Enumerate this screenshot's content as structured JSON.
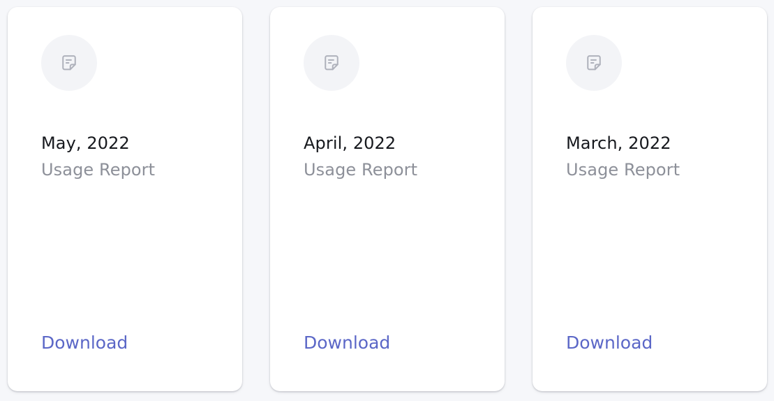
{
  "reports": [
    {
      "period": "May, 2022",
      "subtitle": "Usage Report",
      "action_label": "Download",
      "icon": "note-icon"
    },
    {
      "period": "April, 2022",
      "subtitle": "Usage Report",
      "action_label": "Download",
      "icon": "note-icon"
    },
    {
      "period": "March, 2022",
      "subtitle": "Usage Report",
      "action_label": "Download",
      "icon": "note-icon"
    }
  ],
  "colors": {
    "background": "#f6f7fa",
    "card": "#ffffff",
    "icon_circle": "#f3f4f7",
    "icon_stroke": "#aeb1bb",
    "title": "#16181d",
    "subtitle": "#8d9099",
    "link": "#5b67c7"
  }
}
